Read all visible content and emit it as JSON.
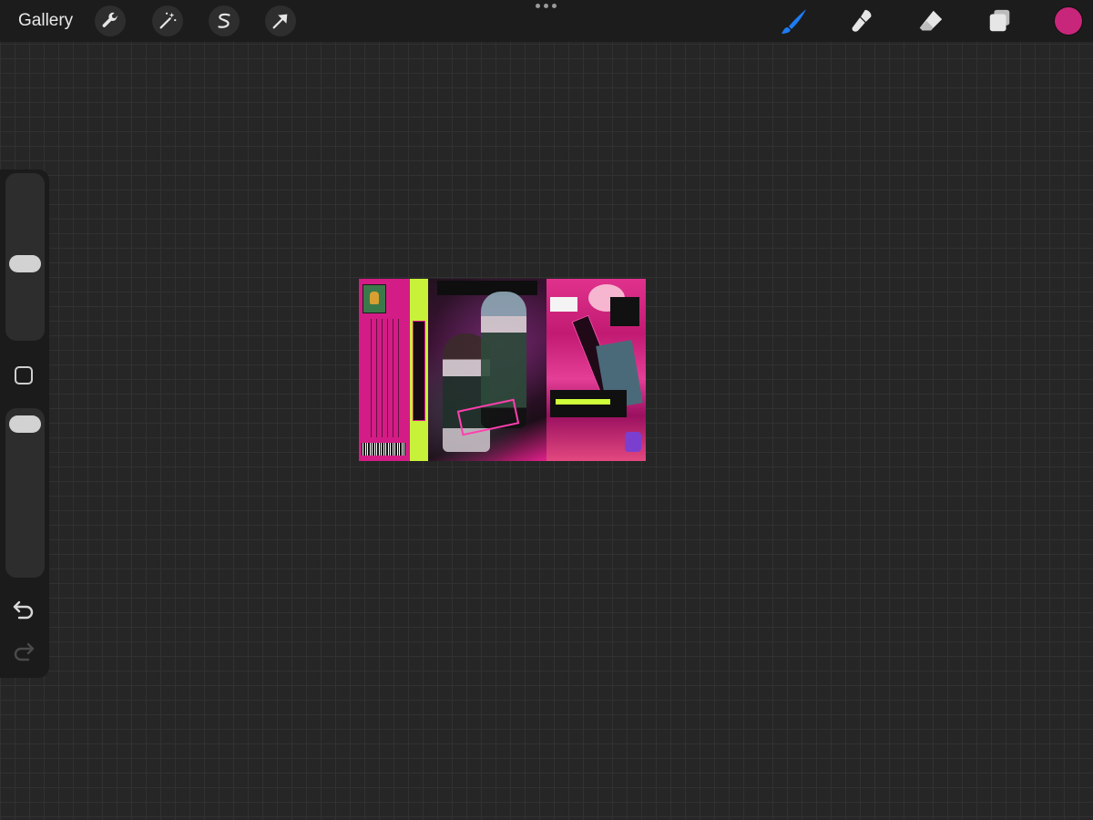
{
  "topbar": {
    "gallery_label": "Gallery",
    "left_tools": [
      "wrench-icon",
      "magic-wand-icon",
      "selection-icon",
      "transform-arrow-icon"
    ],
    "right_tools": [
      "brush-icon",
      "smudge-icon",
      "eraser-icon",
      "layers-icon"
    ],
    "active_tool": "brush-icon",
    "active_tool_color": "#1e7cf2",
    "current_color": "#c8267a"
  },
  "sidebar": {
    "brush_size_level": 0.55,
    "opacity_level": 0.9,
    "controls": [
      "modify-square",
      "undo",
      "redo"
    ]
  },
  "canvas": {
    "background": "#262626",
    "artwork_colors": [
      "#d41c86",
      "#c8f23a",
      "#1a0a14",
      "#e0328c"
    ]
  }
}
